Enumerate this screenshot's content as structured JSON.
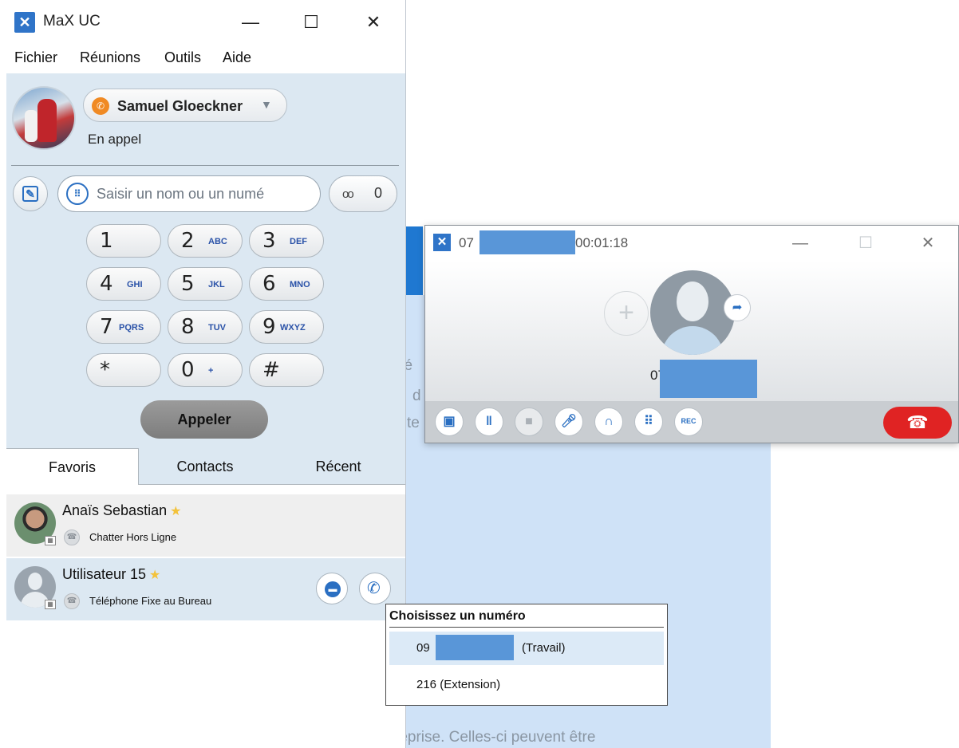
{
  "app": {
    "title": "MaX UC",
    "min": "—",
    "max": "☐",
    "close": "✕"
  },
  "menu": [
    "Fichier",
    "Réunions",
    "Outils",
    "Aide"
  ],
  "profile": {
    "name": "Samuel Gloeckner",
    "status": "En appel",
    "caret": "▼"
  },
  "search": {
    "placeholder": "Saisir un nom ou un numé"
  },
  "voicemail": {
    "icon": "oo",
    "count": "0"
  },
  "keypad": [
    {
      "digit": "1",
      "letters": ""
    },
    {
      "digit": "2",
      "letters": "ABC"
    },
    {
      "digit": "3",
      "letters": "DEF"
    },
    {
      "digit": "4",
      "letters": "GHI"
    },
    {
      "digit": "5",
      "letters": "JKL"
    },
    {
      "digit": "6",
      "letters": "MNO"
    },
    {
      "digit": "7",
      "letters": "PQRS"
    },
    {
      "digit": "8",
      "letters": "TUV"
    },
    {
      "digit": "9",
      "letters": "WXYZ"
    },
    {
      "digit": "*",
      "letters": ""
    },
    {
      "digit": "0",
      "letters": "+"
    },
    {
      "digit": "#",
      "letters": ""
    }
  ],
  "call_button": "Appeler",
  "tabs": [
    "Favoris",
    "Contacts",
    "Récent"
  ],
  "favorites": [
    {
      "name": "Anaïs Sebastian",
      "sub": "Chatter Hors Ligne"
    },
    {
      "name": "Utilisateur 15",
      "sub": "Téléphone Fixe au Bureau"
    }
  ],
  "call_window": {
    "number_prefix": "07",
    "timer": "00:01:18",
    "callee_prefix": "07",
    "rec": "REC"
  },
  "picker": {
    "title": "Choisissez un numéro",
    "options": [
      {
        "prefix": "09",
        "suffix": "(Travail)"
      },
      {
        "label": "216 (Extension)"
      }
    ]
  },
  "background": {
    "fragments": [
      "sé",
      "d",
      "te",
      "reprise. Celles-ci peuvent être"
    ]
  },
  "colors": {
    "accent": "#2a6fc2",
    "panel": "#dce8f2",
    "hangup": "#e02323",
    "status": "#f08a24",
    "redact": "#5996d8"
  }
}
